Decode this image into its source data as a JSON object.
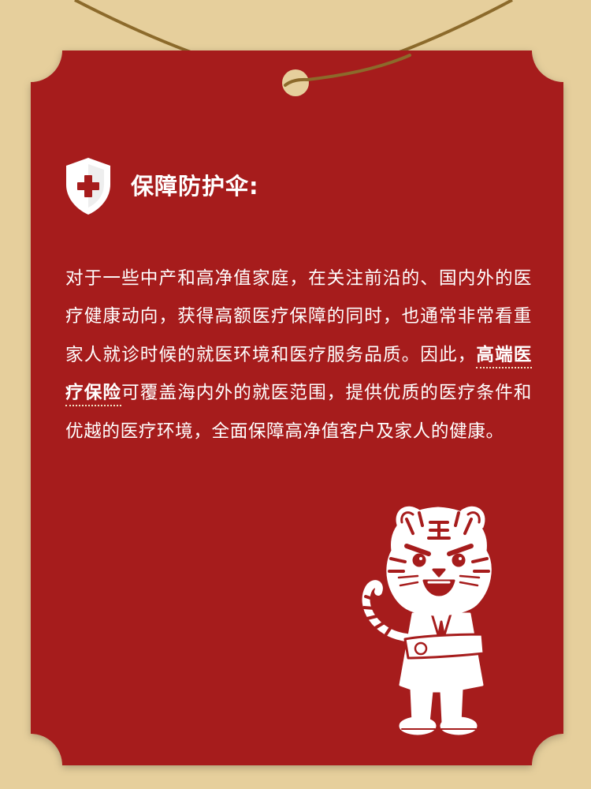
{
  "colors": {
    "background": "#e6cf9c",
    "card": "#a61c1c",
    "string": "#8c6a2b",
    "text": "#ffffff",
    "highlight_underline": "#f2e2c4"
  },
  "section": {
    "icon": "shield-cross-icon",
    "title": "保障防护伞:"
  },
  "paragraph": {
    "before": "对于一些中产和高净值家庭，在关注前沿的、国内外的医疗健康动向，获得高额医疗保障的同时，也通常非常看重家人就诊时候的就医环境和医疗服务品质。因此，",
    "highlight": "高端医疗保险",
    "after": "可覆盖海内外的就医范围，提供优质的医疗条件和优越的医疗环境，全面保障高净值客户及家人的健康。"
  },
  "illustration": {
    "icon": "tiger-in-suit-illustration",
    "face_mark": "王"
  }
}
